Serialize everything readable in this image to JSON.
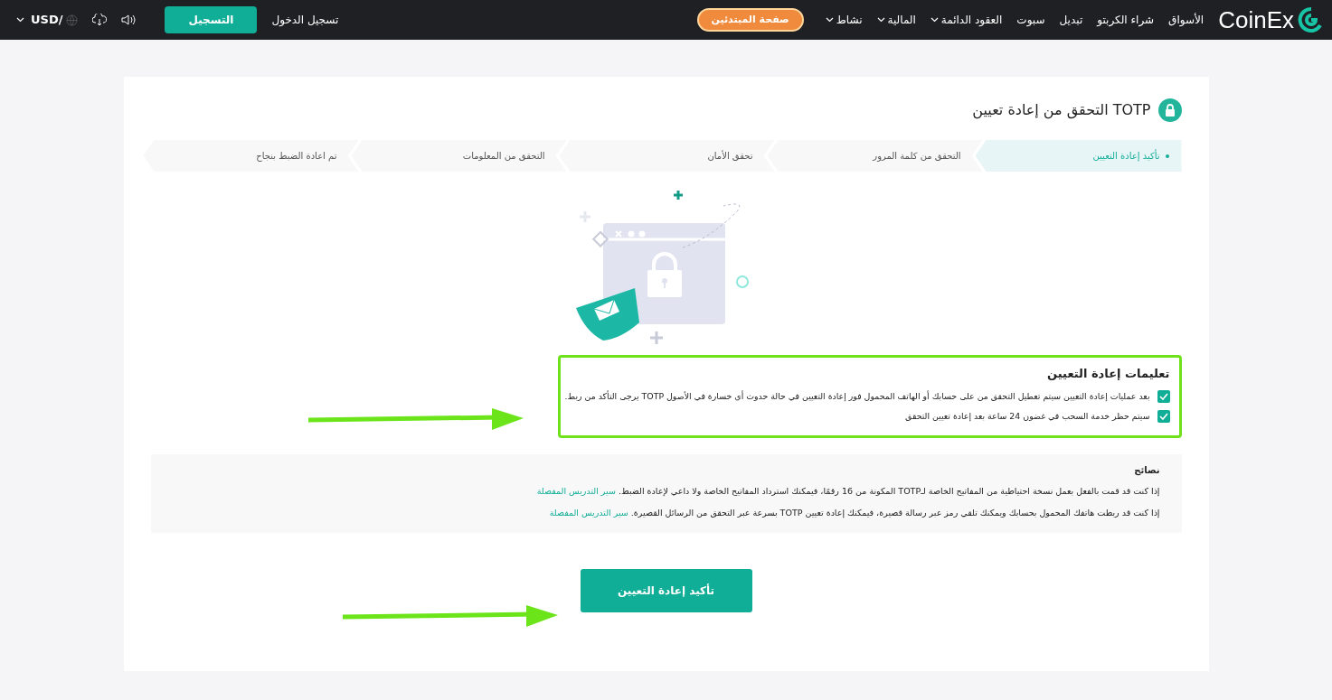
{
  "navbar": {
    "logo": "CoinEx",
    "items": [
      {
        "label": "الأسواق",
        "dropdown": false
      },
      {
        "label": "شراء الكربتو",
        "dropdown": false
      },
      {
        "label": "تبديل",
        "dropdown": false
      },
      {
        "label": "سبوت",
        "dropdown": false
      },
      {
        "label": "العقود الدائمة",
        "dropdown": true
      },
      {
        "label": "المالية",
        "dropdown": true
      },
      {
        "label": "نشاط",
        "dropdown": true
      }
    ],
    "beginner_button": "صفحة المبتدئين",
    "login": "تسجيل الدخول",
    "register": "التسجيل",
    "currency": "USD/"
  },
  "page_title": "TOTP التحقق من إعادة تعيين",
  "steps": [
    {
      "label": "تأكيد إعادة التعيين",
      "selected": true
    },
    {
      "label": "التحقق من كلمة المرور",
      "selected": false
    },
    {
      "label": "تحقق الأمان",
      "selected": false
    },
    {
      "label": "التحقق من المعلومات",
      "selected": false
    },
    {
      "label": "تم اعادة الضبط بنجاح",
      "selected": false
    }
  ],
  "instructions": {
    "title": "تعليمات إعادة التعيين",
    "items": [
      {
        "text": "بعد عمليات إعادة التعيين سيتم تعطيل التحقق من على حسابك أو الهاتف المحمول فور إعادة التعيين في حالة حدوث أي خسارة في الأصول TOTP يرجى التأكد من ربط.",
        "checked": true
      },
      {
        "text": "سيتم حظر خدمة السحب في غضون 24 ساعة بعد إعادة تعيين التحقق",
        "checked": true
      }
    ]
  },
  "tips": {
    "title": "نصائح",
    "items": [
      {
        "text": "إذا كنت قد قمت بالفعل بعمل نسخة احتياطية من المفاتيح الخاصة لـTOTP المكونة من 16 رقمًا، فيمكنك استرداد المفاتيح الخاصة ولا داعي لإعادة الضبط.",
        "link": "سير التدريس المفصلة"
      },
      {
        "text": "إذا كنت قد ربطت هاتفك المحمول بحسابك ويمكنك تلقي رمز عبر رسالة قصيرة، فيمكنك إعادة تعيين TOTP بسرعة عبر التحقق من الرسائل القصيرة.",
        "link": "سير التدريس المفصلة"
      }
    ]
  },
  "confirm_button": "تأكيد إعادة التعيين"
}
